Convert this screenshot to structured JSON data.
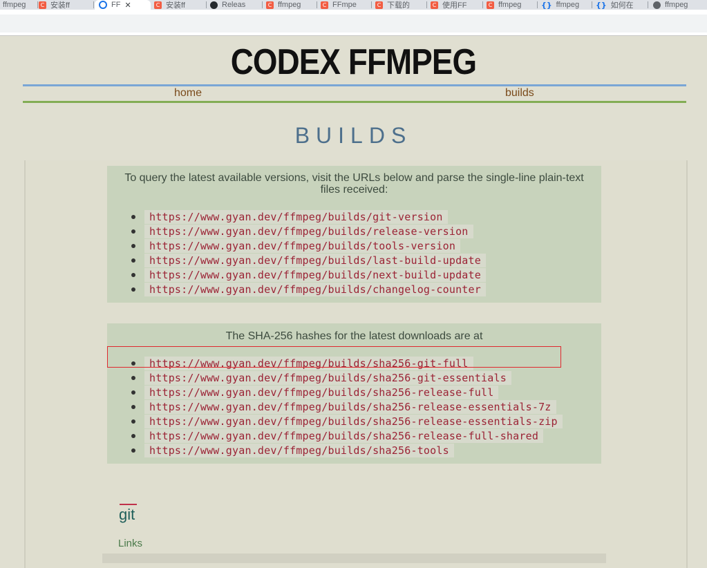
{
  "tabs": [
    {
      "label": "ffmpeg",
      "icon": "csdn-icon"
    },
    {
      "label": "安装ff",
      "icon": "csdn-icon"
    },
    {
      "label": "FF",
      "icon": "chrome-icon",
      "active": true
    },
    {
      "label": "安装ff",
      "icon": "csdn-icon"
    },
    {
      "label": "Releas",
      "icon": "github-icon"
    },
    {
      "label": "ffmpeg",
      "icon": "csdn-icon"
    },
    {
      "label": "FFmpe",
      "icon": "csdn-icon"
    },
    {
      "label": "下载的",
      "icon": "csdn-icon"
    },
    {
      "label": "使用FF",
      "icon": "csdn-icon"
    },
    {
      "label": "ffmpeg",
      "icon": "csdn-icon"
    },
    {
      "label": "ffmpeg",
      "icon": "braces-icon"
    },
    {
      "label": "如何在",
      "icon": "braces-icon"
    },
    {
      "label": "ffmpeg",
      "icon": "globe-icon"
    }
  ],
  "site": {
    "title": "CODEX FFMPEG",
    "nav": {
      "home": "home",
      "builds": "builds"
    },
    "section_heading": "BUILDS"
  },
  "version_box": {
    "intro": "To query the latest available versions, visit the URLs below and parse the single-line plain-text files received:",
    "urls": [
      "https://www.gyan.dev/ffmpeg/builds/git-version",
      "https://www.gyan.dev/ffmpeg/builds/release-version",
      "https://www.gyan.dev/ffmpeg/builds/tools-version",
      "https://www.gyan.dev/ffmpeg/builds/last-build-update",
      "https://www.gyan.dev/ffmpeg/builds/next-build-update",
      "https://www.gyan.dev/ffmpeg/builds/changelog-counter"
    ]
  },
  "hash_box": {
    "intro": "The SHA-256 hashes for the latest downloads are at",
    "urls": [
      "https://www.gyan.dev/ffmpeg/builds/sha256-git-full",
      "https://www.gyan.dev/ffmpeg/builds/sha256-git-essentials",
      "https://www.gyan.dev/ffmpeg/builds/sha256-release-full",
      "https://www.gyan.dev/ffmpeg/builds/sha256-release-essentials-7z",
      "https://www.gyan.dev/ffmpeg/builds/sha256-release-essentials-zip",
      "https://www.gyan.dev/ffmpeg/builds/sha256-release-full-shared",
      "https://www.gyan.dev/ffmpeg/builds/sha256-tools"
    ]
  },
  "git_section": {
    "heading": "git",
    "links_label": "Links"
  },
  "colors": {
    "page_bg": "#e0dfd1",
    "box_bg": "#c8d3bc",
    "nav_top_line": "#7aa6d6",
    "nav_bottom_line": "#83ad55",
    "heading_blue": "#4d6f8c",
    "url_red": "#9b2335",
    "highlight_red": "#e0282e"
  }
}
